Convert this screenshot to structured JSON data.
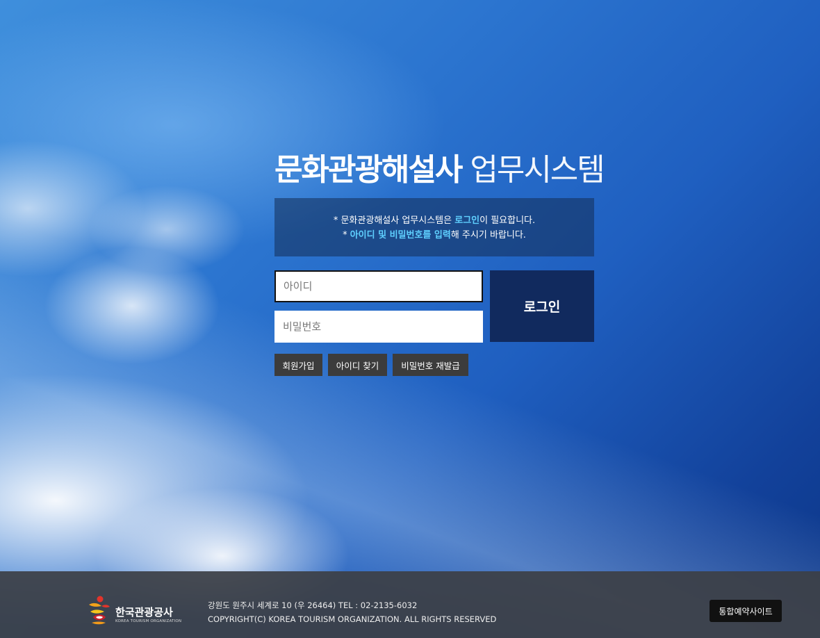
{
  "title": {
    "bold": "문화관광해설사",
    "light": " 업무시스템"
  },
  "notice": {
    "line1_prefix": "* 문화관광해설사 업무시스템은 ",
    "line1_highlight": "로그인",
    "line1_suffix": "이 필요합니다.",
    "line2_prefix": "* ",
    "line2_highlight": "아이디 및 비밀번호를 입력",
    "line2_suffix": "해 주시기 바랍니다."
  },
  "form": {
    "id_placeholder": "아이디",
    "id_value": "",
    "pw_placeholder": "비밀번호",
    "pw_value": "",
    "login_label": "로그인"
  },
  "links": {
    "join": "회원가입",
    "find_id": "아이디 찾기",
    "reset_pw": "비밀번호 재발급"
  },
  "footer": {
    "logo_name": "한국관광공사",
    "logo_sub": "KOREA TOURISM ORGANIZATION",
    "address": "강원도 원주시 세계로 10 (우 26464) TEL : 02-2135-6032",
    "copyright": "COPYRIGHT(C) KOREA TOURISM ORGANIZATION. ALL RIGHTS RESERVED",
    "reserve_button": "통합예약사이트"
  },
  "colors": {
    "highlight": "#5fd0ff",
    "login_button": "#112a5e",
    "sub_button": "#3c3c3c",
    "footer_bg": "#3c4046"
  },
  "icons": {
    "logo": "kto-logo-icon"
  }
}
